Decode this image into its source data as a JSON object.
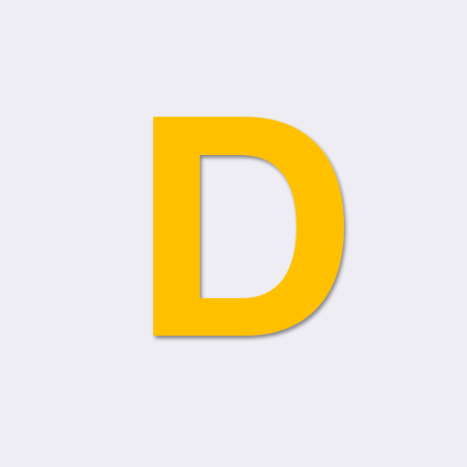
{
  "logo": {
    "letter": "D",
    "fill_color": "#FFC000",
    "shadow_color": "#b9b9c0",
    "background_color": "#ededf3"
  }
}
